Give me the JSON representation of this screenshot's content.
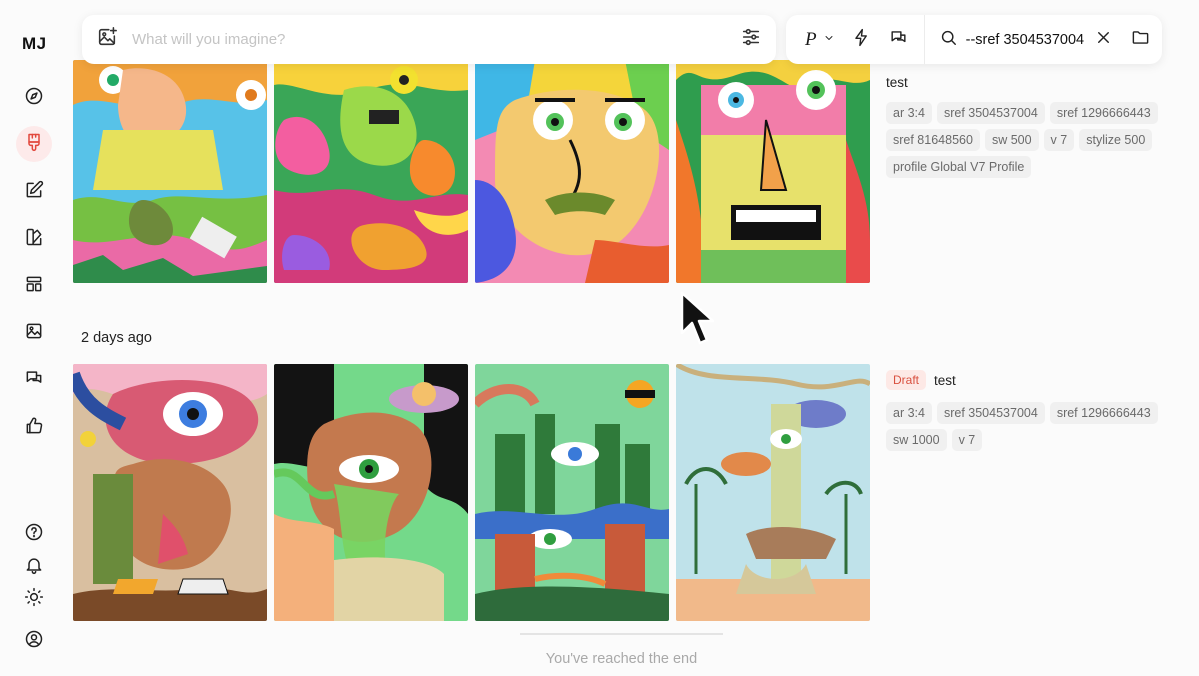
{
  "app": {
    "logo": "MJ"
  },
  "sidebar": {
    "items": [
      {
        "name": "explore",
        "icon": "compass-icon"
      },
      {
        "name": "create",
        "icon": "brush-icon",
        "active": true
      },
      {
        "name": "edit",
        "icon": "edit-icon"
      },
      {
        "name": "personalize",
        "icon": "palette-icon"
      },
      {
        "name": "organize",
        "icon": "layout-icon"
      },
      {
        "name": "gallery",
        "icon": "image-icon"
      },
      {
        "name": "chat",
        "icon": "chat-icon"
      },
      {
        "name": "rate",
        "icon": "thumbs-up-icon"
      }
    ],
    "bottom": [
      {
        "name": "help",
        "icon": "help-icon"
      },
      {
        "name": "notifications",
        "icon": "bell-icon"
      },
      {
        "name": "theme",
        "icon": "sun-icon"
      },
      {
        "name": "profile",
        "icon": "user-icon"
      }
    ]
  },
  "prompt": {
    "placeholder": "What will you imagine?"
  },
  "toolbar": {
    "personalize_label": "P",
    "search_value": "--sref 3504537004"
  },
  "sections": [
    {
      "label": "",
      "title": "test",
      "draft": "",
      "chips": [
        "ar 3:4",
        "sref 3504537004",
        "sref 1296666443",
        "sref 81648560",
        "sw 500",
        "v 7",
        "stylize 500",
        "profile Global V7 Profile"
      ]
    },
    {
      "label": "2 days ago",
      "title": "test",
      "draft": "Draft",
      "chips": [
        "ar 3:4",
        "sref 3504537004",
        "sref 1296666443",
        "sw 1000",
        "v 7"
      ]
    }
  ],
  "footer": {
    "end_text": "You've reached the end"
  },
  "colors": {
    "accent": "#e2483d",
    "accent_bg": "#fdeaea",
    "chip_bg": "#f0f0f0"
  }
}
